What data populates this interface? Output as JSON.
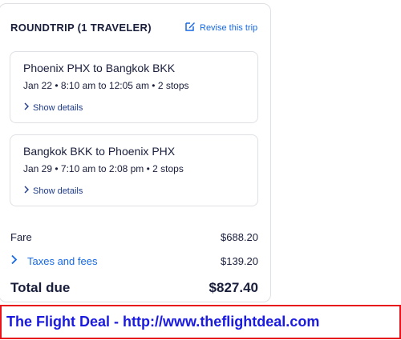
{
  "trip": {
    "header": "ROUNDTRIP (1 TRAVELER)",
    "revise_label": "Revise this trip"
  },
  "legs": [
    {
      "route": "Phoenix PHX to Bangkok BKK",
      "times": "Jan 22 • 8:10 am to 12:05 am • 2 stops",
      "details_label": "Show details"
    },
    {
      "route": "Bangkok BKK to Phoenix PHX",
      "times": "Jan 29 • 7:10 am to 2:08 pm • 2 stops",
      "details_label": "Show details"
    }
  ],
  "pricing": {
    "fare_label": "Fare",
    "fare_value": "$688.20",
    "taxes_label": "Taxes and fees",
    "taxes_value": "$139.20",
    "total_label": "Total due",
    "total_value": "$827.40"
  },
  "banner": {
    "text": "The Flight Deal - http://www.theflightdeal.com"
  },
  "colors": {
    "link": "#1668e3",
    "text": "#191e3b",
    "banner_border": "#e8141b",
    "banner_text": "#1a1ae0"
  },
  "icons": {
    "revise": "edit-pencil-icon",
    "details": "chevron-right-icon",
    "taxes": "chevron-right-icon"
  }
}
